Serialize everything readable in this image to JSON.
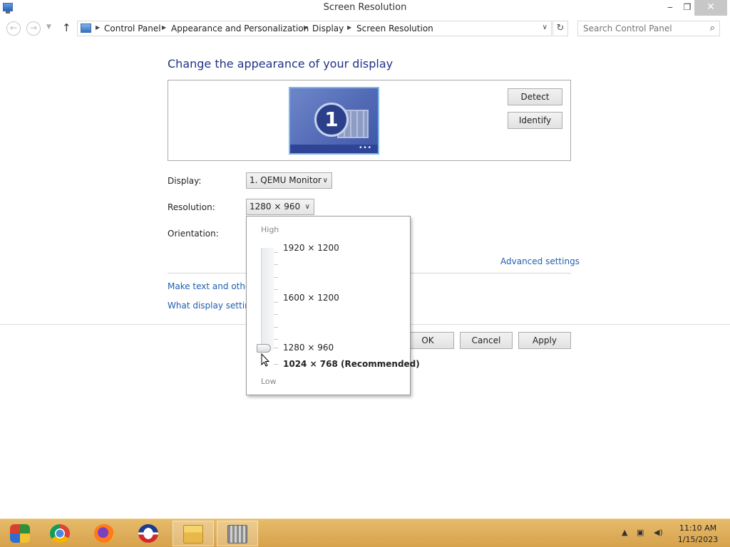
{
  "window": {
    "title": "Screen Resolution",
    "min": "‒",
    "max": "❐",
    "close": "✕"
  },
  "navbar": {
    "back": "←",
    "forward": "→",
    "recent": "▼",
    "up": "↑",
    "breadcrumbs": [
      "Control Panel",
      "Appearance and Personalization",
      "Display",
      "Screen Resolution"
    ],
    "dropdown": "∨",
    "refresh": "↻",
    "search_placeholder": "Search Control Panel",
    "search_icon": "⌕"
  },
  "main": {
    "heading": "Change the appearance of your display",
    "monitor_number": "1",
    "detect_label": "Detect",
    "identify_label": "Identify",
    "display_label": "Display:",
    "display_value": "1. QEMU Monitor",
    "resolution_label": "Resolution:",
    "resolution_value": "1280 × 960",
    "orientation_label": "Orientation:",
    "advanced_link": "Advanced settings",
    "link_text_size": "Make text and other",
    "link_display_settings": "What display settin",
    "ok_label": "OK",
    "cancel_label": "Cancel",
    "apply_label": "Apply"
  },
  "resolution_popup": {
    "high_label": "High",
    "low_label": "Low",
    "options": [
      "1920 × 1200",
      "1600 × 1200",
      "1280 × 960",
      "1024 × 768 (Recommended)"
    ],
    "selected": "1280 × 960"
  },
  "taskbar": {
    "icons": [
      "media-center-icon",
      "chrome-icon",
      "firefox-icon",
      "opera-icon",
      "file-explorer-icon",
      "control-panel-icon"
    ],
    "time": "11:10 AM",
    "date": "1/15/2023",
    "tray_up": "▲"
  },
  "colors": {
    "link": "#1d5fb0",
    "heading": "#1e3287",
    "taskbar": "#d7a24c"
  }
}
